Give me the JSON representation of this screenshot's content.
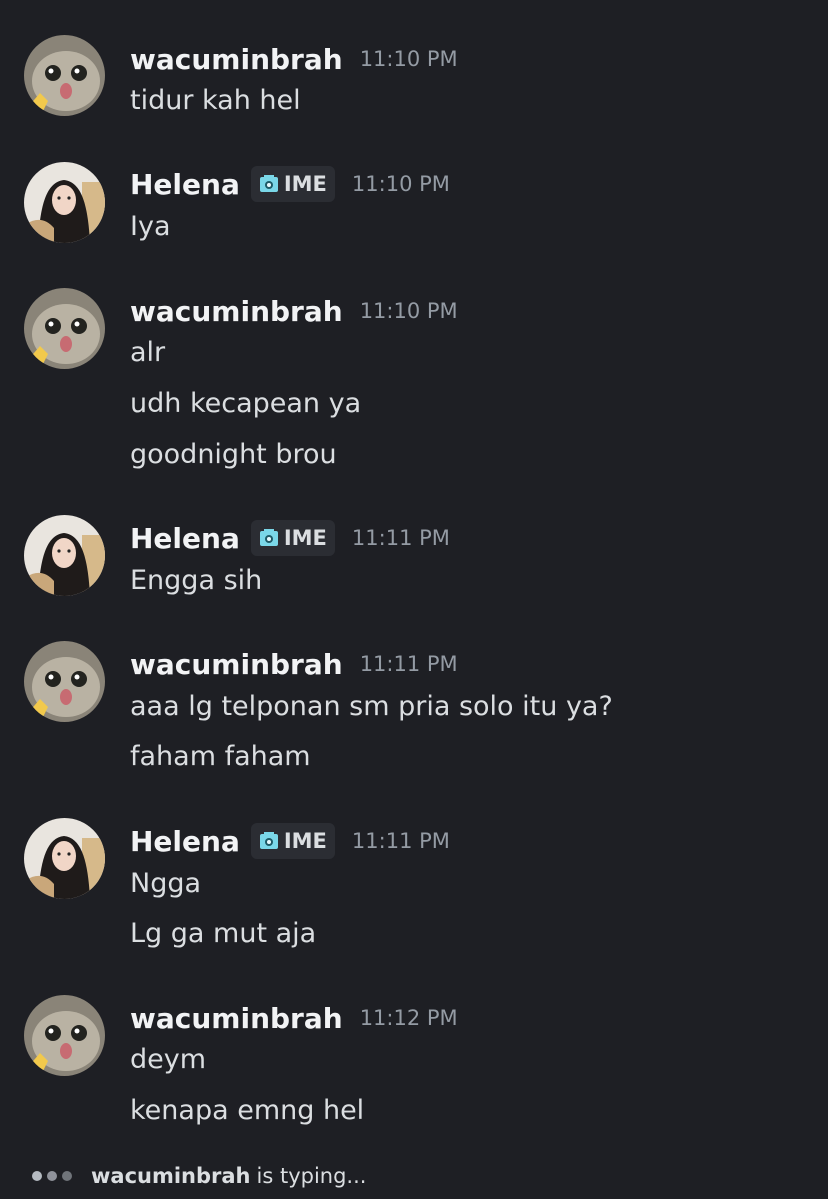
{
  "messages": [
    {
      "user": "wacuminbrah",
      "time": "11:10 PM",
      "lines": [
        "tidur kah hel"
      ]
    },
    {
      "user": "Helena",
      "badge": "IME",
      "time": "11:10 PM",
      "lines": [
        "Iya"
      ]
    },
    {
      "user": "wacuminbrah",
      "time": "11:10 PM",
      "lines": [
        "alr",
        "udh kecapean ya",
        "goodnight brou"
      ]
    },
    {
      "user": "Helena",
      "badge": "IME",
      "time": "11:11 PM",
      "lines": [
        "Engga sih"
      ]
    },
    {
      "user": "wacuminbrah",
      "time": "11:11 PM",
      "lines": [
        "aaa lg telponan sm pria solo itu ya?",
        "faham faham"
      ]
    },
    {
      "user": "Helena",
      "badge": "IME",
      "time": "11:11 PM",
      "lines": [
        "Ngga",
        "Lg ga mut aja"
      ]
    },
    {
      "user": "wacuminbrah",
      "time": "11:12 PM",
      "lines": [
        "deym",
        "kenapa emng hel"
      ]
    }
  ],
  "typing": {
    "user": "wacuminbrah",
    "text": "is typing..."
  },
  "icons": {
    "badge": "server-tag-icon",
    "avatar_cat": "cat-avatar",
    "avatar_helena": "user-photo-avatar"
  }
}
